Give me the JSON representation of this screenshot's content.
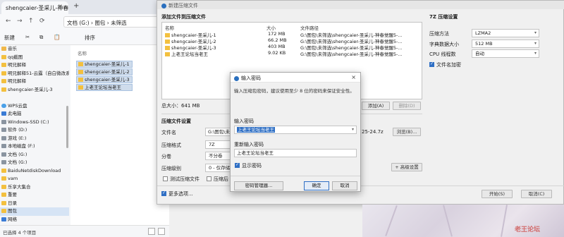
{
  "explorer": {
    "tab_title": "shengcaier-圣采儿-神春觉醒5-...",
    "tab_close": "×",
    "tab_new": "+",
    "nav": {
      "back": "←",
      "forward": "→",
      "up": "↑",
      "refresh": "⟳"
    },
    "address": [
      "文档 (G:)",
      "图包",
      "未筛选"
    ],
    "address_sep": "›",
    "toolbar": {
      "new_label": "新建",
      "sort_label": "排序"
    },
    "sidebar": [
      {
        "label": "音乐",
        "icon": "music-icon"
      },
      {
        "label": "qq截图",
        "icon": "folder-icon"
      },
      {
        "label": "明兄解释",
        "icon": "folder-icon"
      },
      {
        "label": "明兄解释51-云露（自白微改系列）",
        "icon": "folder-icon"
      },
      {
        "label": "明兄解释",
        "icon": "folder-icon"
      },
      {
        "label": "shengcaier-圣采儿-3",
        "icon": "folder-icon"
      },
      {
        "label": "",
        "icon": ""
      },
      {
        "label": "WPS云盘",
        "icon": "cloud-icon"
      },
      {
        "label": "此电脑",
        "icon": "computer-icon"
      },
      {
        "label": "Windows-SSD (C:)",
        "icon": "drive-icon"
      },
      {
        "label": "软件 (D:)",
        "icon": "drive-icon"
      },
      {
        "label": "游戏 (E:)",
        "icon": "drive-icon"
      },
      {
        "label": "本地磁盘 (F:)",
        "icon": "drive-icon"
      },
      {
        "label": "文档 (G:)",
        "icon": "drive-icon"
      },
      {
        "label": "文档 (G:)",
        "icon": "drive-icon"
      },
      {
        "label": "BaiduNetdiskDownload",
        "icon": "folder-icon"
      },
      {
        "label": "vam",
        "icon": "folder-icon"
      },
      {
        "label": "乐享大集合",
        "icon": "folder-icon"
      },
      {
        "label": "重要",
        "icon": "folder-icon"
      },
      {
        "label": "日录",
        "icon": "folder-icon"
      },
      {
        "label": "图包",
        "icon": "folder-icon"
      },
      {
        "label": "网络",
        "icon": "network-icon"
      }
    ],
    "column_name": "名称",
    "files": [
      "shengcaier-圣采儿-1",
      "shengcaier-圣采儿-2",
      "shengcaier-圣采儿-3",
      "上老王论坛当老王"
    ],
    "status": "已选择 4 个项目"
  },
  "archive": {
    "title": "新建压缩文件",
    "section_add": "添加文件到压缩文件",
    "columns": {
      "name": "名称",
      "size": "大小",
      "path": "文件路径"
    },
    "rows": [
      {
        "name": "shengcaier-圣采儿-1",
        "size": "172 MB",
        "path": "G:\\图包\\未筛选\\shengcaier-圣采儿-神春觉醒5-..."
      },
      {
        "name": "shengcaier-圣采儿-2",
        "size": "66.2 MB",
        "path": "G:\\图包\\未筛选\\shengcaier-圣采儿-神春觉醒5-..."
      },
      {
        "name": "shengcaier-圣采儿-3",
        "size": "403 MB",
        "path": "G:\\图包\\未筛选\\shengcaier-圣采儿-神春觉醒5-..."
      },
      {
        "name": "上老王论坛当老王",
        "size": "9.02 KB",
        "path": "G:\\图包\\未筛选\\shengcaier-圣采儿-神春觉醒5-..."
      }
    ],
    "total": "总大小：641 MB",
    "add_button": "添加(A)",
    "delete_button": "删除(D)",
    "settings_title": "压缩文件设置",
    "filename_label": "文件名",
    "filename_value": "G:\\图包\\未筛选\\",
    "filename_suffix": "25-24.7z",
    "browse_button": "浏览(B)...",
    "format_label": "压缩格式",
    "format_value": "7Z",
    "split_label": "分卷",
    "split_value": "不分卷",
    "level_label": "压缩级别",
    "level_value": "0 - 仅存储",
    "test_label": "测试压缩文件",
    "delete_source_label": "压缩后",
    "advanced_button": "+ 高级设置",
    "more_options": "更多选项...",
    "right_title": "7Z 压缩设置",
    "method_label": "压缩方法",
    "method_value": "LZMA2",
    "dict_label": "字典数据大小",
    "dict_value": "512 MB",
    "cpu_label": "CPU 线程数",
    "cpu_value": "自动",
    "encrypt_names": "文件名加密",
    "start_button": "开始(S)",
    "cancel_button": "取消(C)"
  },
  "password": {
    "title": "输入密码",
    "close": "×",
    "note": "输入压缩包密码，建议使用至少 8 位的密码来保证安全性。",
    "enter_label": "输入密码",
    "enter_value": "上老王论坛当老王",
    "confirm_label": "重新输入密码",
    "confirm_value": "上老王论坛当老王",
    "show_password": "显示密码",
    "manager_button": "密码管理器...",
    "ok_button": "确定",
    "cancel_button": "取消"
  },
  "watermark": "老王论坛"
}
